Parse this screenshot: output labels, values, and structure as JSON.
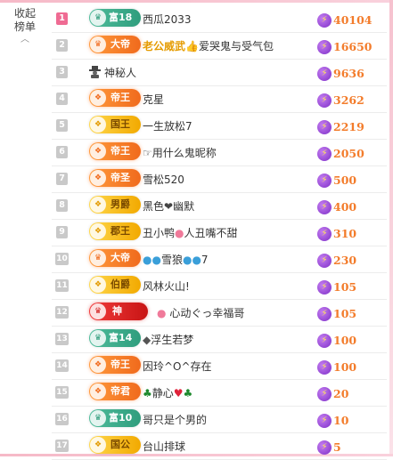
{
  "sidebar": {
    "collapse_line1": "收起",
    "collapse_line2": "榜单",
    "collapse_icon": "chevron-up-icon"
  },
  "leaderboard": {
    "score_icon": "lightning-bolt-icon",
    "rows": [
      {
        "rank": "1",
        "badge": "富18",
        "badge_color": "green",
        "badge_icon": "crown-icon",
        "name": "西瓜2033",
        "score": "40104"
      },
      {
        "rank": "2",
        "badge": "大帝",
        "badge_color": "orange",
        "badge_icon": "crown-icon",
        "name": "老公威武",
        "name_suffix": "👍爱哭鬼与受气包",
        "score": "16650"
      },
      {
        "rank": "3",
        "badge": "",
        "badge_color": "",
        "badge_icon": "",
        "name": "神秘人",
        "name_prefix_icon": "mystery-user-icon",
        "score": "9636"
      },
      {
        "rank": "4",
        "badge": "帝王",
        "badge_color": "orange",
        "badge_icon": "emblem-icon",
        "name": "克星",
        "score": "3262"
      },
      {
        "rank": "5",
        "badge": "国王",
        "badge_color": "gold",
        "badge_icon": "emblem-icon",
        "name": "一生放松7",
        "score": "2219"
      },
      {
        "rank": "6",
        "badge": "帝王",
        "badge_color": "orange",
        "badge_icon": "emblem-icon",
        "name": "☞用什么鬼昵称",
        "score": "2050"
      },
      {
        "rank": "7",
        "badge": "帝圣",
        "badge_color": "orange",
        "badge_icon": "emblem-icon",
        "name": "雪松520",
        "score": "500"
      },
      {
        "rank": "8",
        "badge": "男爵",
        "badge_color": "gold",
        "badge_icon": "emblem-icon",
        "name": "黑色",
        "name_suffix": "幽默",
        "name_mid_icon": "dark-heart",
        "score": "400"
      },
      {
        "rank": "9",
        "badge": "郡王",
        "badge_color": "gold",
        "badge_icon": "emblem-icon",
        "name": "丑小鸭",
        "name_suffix": "人丑嘴不甜",
        "name_mid_icon": "pig",
        "score": "310"
      },
      {
        "rank": "10",
        "badge": "大帝",
        "badge_color": "orange",
        "badge_icon": "crown-icon",
        "name": "雪狼",
        "name_suffix": "7",
        "name_pre_icon": "drops",
        "name_mid_icon": "drops",
        "score": "230"
      },
      {
        "rank": "11",
        "badge": "伯爵",
        "badge_color": "gold",
        "badge_icon": "emblem-icon",
        "name": "风林火山!",
        "score": "105"
      },
      {
        "rank": "12",
        "badge": "神",
        "badge_color": "red",
        "badge_icon": "crown-icon",
        "name": "心动ぐっ幸福哥",
        "name_pre_icon": "pig",
        "score": "105"
      },
      {
        "rank": "13",
        "badge": "富14",
        "badge_color": "green",
        "badge_icon": "crown-icon",
        "name": "浮生若梦",
        "name_pre_icon": "wolf",
        "score": "100"
      },
      {
        "rank": "14",
        "badge": "帝王",
        "badge_color": "orange",
        "badge_icon": "emblem-icon",
        "name": "因玲^O^存在",
        "score": "100"
      },
      {
        "rank": "15",
        "badge": "帝君",
        "badge_color": "orange",
        "badge_icon": "emblem-icon",
        "name": "静心",
        "name_pre_icon": "clover",
        "name_mid_icon": "heart",
        "name_suffix_icon": "clover",
        "score": "20"
      },
      {
        "rank": "16",
        "badge": "富10",
        "badge_color": "green",
        "badge_icon": "crown-icon",
        "name": "哥只是个男的",
        "score": "10"
      },
      {
        "rank": "17",
        "badge": "国公",
        "badge_color": "gold",
        "badge_icon": "emblem-icon",
        "name": "台山排球",
        "score": "5"
      }
    ]
  }
}
